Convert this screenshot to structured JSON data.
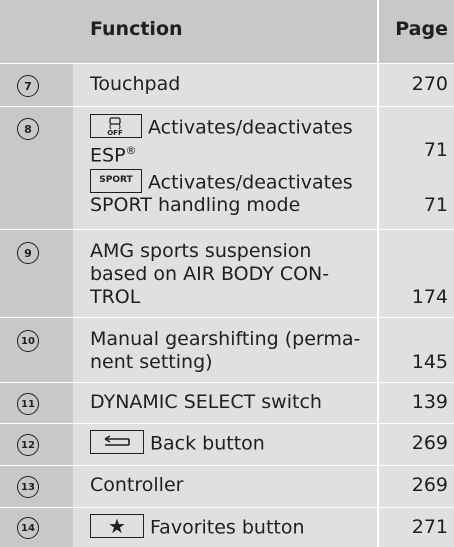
{
  "header": {
    "function": "Function",
    "page": "Page"
  },
  "rows": [
    {
      "num": "7",
      "lines": [
        "Touchpad"
      ],
      "page": "270"
    },
    {
      "num": "8",
      "items": [
        {
          "key": "esp-off-icon",
          "label_line1": "Activates/deactivates",
          "label_line2": "ESP",
          "sup": "®",
          "page": "71"
        },
        {
          "key": "SPORT",
          "label_line1": "Activates/deactivates",
          "label_line2": "SPORT handling mode",
          "page": "71"
        }
      ]
    },
    {
      "num": "9",
      "lines": [
        "AMG sports suspension",
        "based on AIR BODY CON-",
        "TROL"
      ],
      "page": "174"
    },
    {
      "num": "10",
      "lines": [
        "Manual gearshifting (perma-",
        "nent setting)"
      ],
      "page": "145"
    },
    {
      "num": "11",
      "lines": [
        "DYNAMIC SELECT switch"
      ],
      "page": "139"
    },
    {
      "num": "12",
      "key": "back-icon",
      "lines": [
        "Back button"
      ],
      "page": "269"
    },
    {
      "num": "13",
      "lines": [
        "Controller"
      ],
      "page": "269"
    },
    {
      "num": "14",
      "key": "★",
      "lines": [
        "Favorites button"
      ],
      "page": "271"
    }
  ]
}
